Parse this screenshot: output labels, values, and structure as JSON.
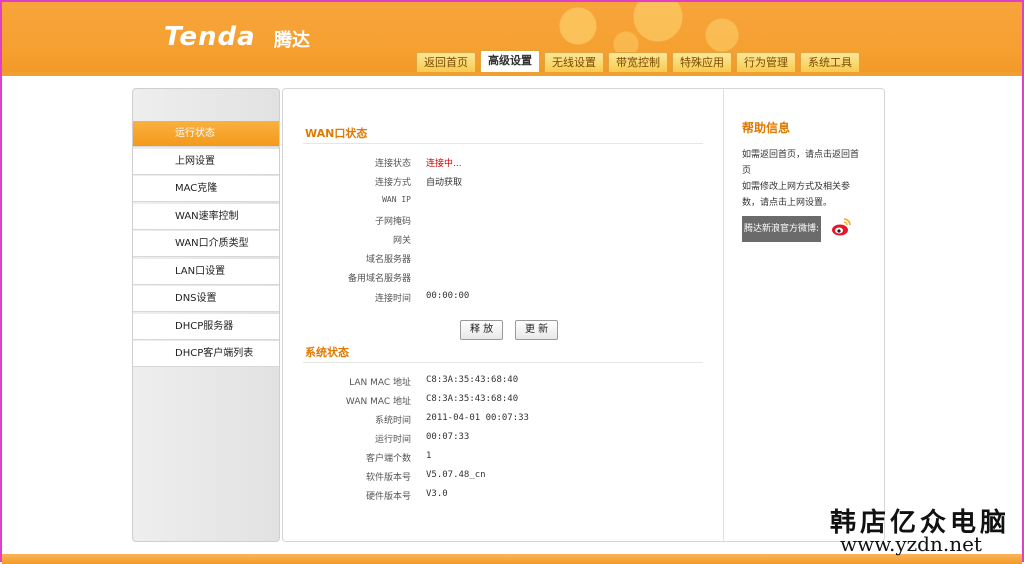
{
  "header": {
    "logo_text": "Tenda",
    "logo_cn": "腾达",
    "tabs": [
      {
        "label": "返回首页",
        "active": false
      },
      {
        "label": "高级设置",
        "active": true
      },
      {
        "label": "无线设置",
        "active": false
      },
      {
        "label": "带宽控制",
        "active": false
      },
      {
        "label": "特殊应用",
        "active": false
      },
      {
        "label": "行为管理",
        "active": false
      },
      {
        "label": "系统工具",
        "active": false
      }
    ]
  },
  "sidebar": {
    "items": [
      {
        "label": "运行状态",
        "active": true
      },
      {
        "label": "上网设置",
        "active": false
      },
      {
        "label": "MAC克隆",
        "active": false
      },
      {
        "label": "WAN速率控制",
        "active": false
      },
      {
        "label": "WAN口介质类型",
        "active": false
      },
      {
        "label": "LAN口设置",
        "active": false
      },
      {
        "label": "DNS设置",
        "active": false
      },
      {
        "label": "DHCP服务器",
        "active": false
      },
      {
        "label": "DHCP客户端列表",
        "active": false
      }
    ]
  },
  "wan_status": {
    "title": "WAN口状态",
    "rows": [
      {
        "label": "连接状态",
        "value": "连接中..."
      },
      {
        "label": "连接方式",
        "value": "自动获取"
      },
      {
        "label": "WAN IP",
        "value": ""
      },
      {
        "label": "子网掩码",
        "value": ""
      },
      {
        "label": "网关",
        "value": ""
      },
      {
        "label": "域名服务器",
        "value": ""
      },
      {
        "label": "备用域名服务器",
        "value": ""
      },
      {
        "label": "连接时间",
        "value": "00:00:00"
      }
    ],
    "release_button": "释 放",
    "renew_button": "更 新"
  },
  "system_status": {
    "title": "系统状态",
    "rows": [
      {
        "label": "LAN MAC 地址",
        "value": "C8:3A:35:43:68:40"
      },
      {
        "label": "WAN MAC 地址",
        "value": "C8:3A:35:43:68:40"
      },
      {
        "label": "系统时间",
        "value": "2011-04-01 00:07:33"
      },
      {
        "label": "运行时间",
        "value": "00:07:33"
      },
      {
        "label": "客户端个数",
        "value": "1"
      },
      {
        "label": "软件版本号",
        "value": "V5.07.48_cn"
      },
      {
        "label": "硬件版本号",
        "value": "V3.0"
      }
    ]
  },
  "help": {
    "title": "帮助信息",
    "text": "如需返回首页，请点击返回首页\n如需修改上网方式及相关参数，请点击上网设置。",
    "weibo_label": "腾达新浪官方微博:",
    "weibo_icon": "weibo-icon"
  },
  "watermark": {
    "name": "韩店亿众电脑",
    "url": "www.yzdn.net"
  },
  "colors": {
    "brand_orange": "#f5a030",
    "section_title": "#e07a00",
    "status_red": "#d00000"
  }
}
